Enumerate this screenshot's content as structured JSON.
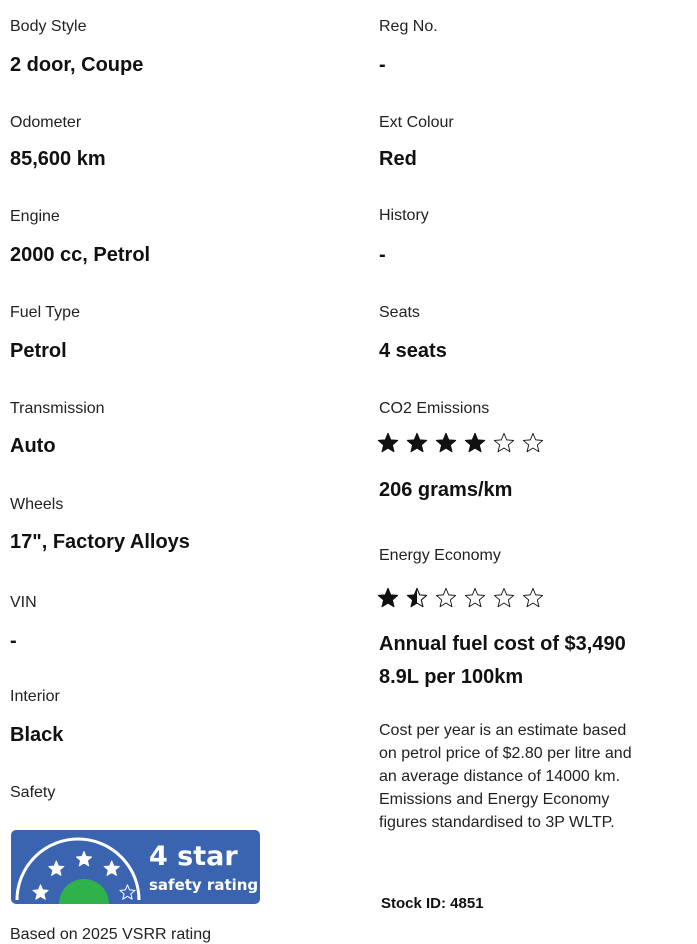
{
  "specs_left": {
    "body_style": {
      "label": "Body Style",
      "value": "2 door, Coupe"
    },
    "odometer": {
      "label": "Odometer",
      "value": "85,600 km"
    },
    "engine": {
      "label": "Engine",
      "value": "2000 cc, Petrol"
    },
    "fuel_type": {
      "label": "Fuel Type",
      "value": "Petrol"
    },
    "transmission": {
      "label": "Transmission",
      "value": "Auto"
    },
    "wheels": {
      "label": "Wheels",
      "value": "17\", Factory Alloys"
    },
    "vin": {
      "label": "VIN",
      "value": "-"
    },
    "interior": {
      "label": "Interior",
      "value": "Black"
    },
    "safety": {
      "label": "Safety",
      "badge_main": "4 star",
      "badge_sub": "safety rating",
      "badge_stars": 4,
      "badge_max": 5,
      "note": "Based on 2025 VSRR rating"
    }
  },
  "specs_right": {
    "reg_no": {
      "label": "Reg No.",
      "value": "-"
    },
    "ext_colour": {
      "label": "Ext Colour",
      "value": "Red"
    },
    "history": {
      "label": "History",
      "value": "-"
    },
    "seats": {
      "label": "Seats",
      "value": "4 seats"
    },
    "co2": {
      "label": "CO2 Emissions",
      "rating": 4,
      "max": 6,
      "value": "206 grams/km"
    },
    "energy": {
      "label": "Energy Economy",
      "rating": 1.5,
      "max": 6,
      "annual_cost": "Annual fuel cost of $3,490",
      "consumption": "8.9L per 100km"
    },
    "disclaimer": [
      "Cost per year is an estimate based",
      "on petrol price of  $2.80 per litre and",
      "an average distance of 14000 km.",
      "Emissions and Energy Economy",
      "figures standardised to 3P WLTP."
    ],
    "stock_id": "Stock ID: 4851"
  },
  "colors": {
    "badge_blue": "#3a63b0",
    "badge_green": "#2fb24a",
    "star_fill": "#111111",
    "badge_text": "#ffffff"
  }
}
